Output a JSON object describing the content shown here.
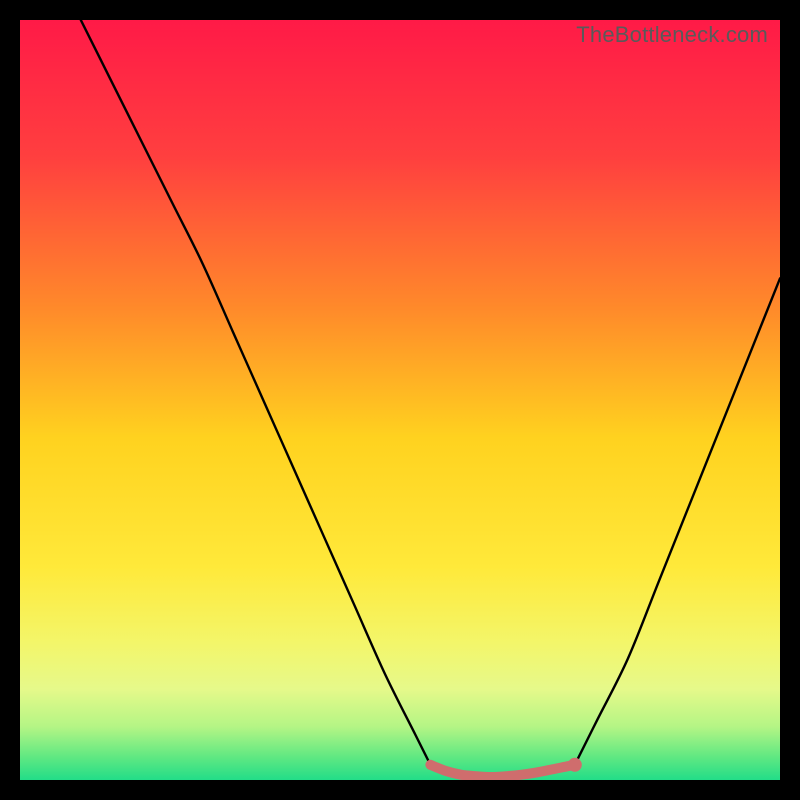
{
  "watermark": {
    "text": "TheBottleneck.com"
  },
  "chart_data": {
    "type": "line",
    "title": "",
    "xlabel": "",
    "ylabel": "",
    "xlim": [
      0,
      100
    ],
    "ylim": [
      0,
      100
    ],
    "series": [
      {
        "name": "curve-left",
        "x": [
          8,
          12,
          16,
          20,
          24,
          28,
          32,
          36,
          40,
          44,
          48,
          52,
          54
        ],
        "y": [
          100,
          92,
          84,
          76,
          68,
          59,
          50,
          41,
          32,
          23,
          14,
          6,
          2
        ],
        "color": "#000000"
      },
      {
        "name": "curve-right",
        "x": [
          73,
          76,
          80,
          84,
          88,
          92,
          96,
          100
        ],
        "y": [
          2,
          8,
          16,
          26,
          36,
          46,
          56,
          66
        ],
        "color": "#000000"
      },
      {
        "name": "highlight-flat",
        "x": [
          54,
          56,
          58,
          60,
          62,
          64,
          66,
          68,
          70,
          72,
          73
        ],
        "y": [
          2,
          1.2,
          0.7,
          0.5,
          0.4,
          0.5,
          0.7,
          1.0,
          1.4,
          1.8,
          2
        ],
        "color": "#cf6d6d"
      }
    ],
    "highlight_endpoint": {
      "x": 73,
      "y": 2,
      "color": "#cf6d6d"
    },
    "background_gradient": {
      "stops": [
        {
          "pct": 0,
          "color": "#ff1a47"
        },
        {
          "pct": 18,
          "color": "#ff3f3f"
        },
        {
          "pct": 38,
          "color": "#ff8a2a"
        },
        {
          "pct": 55,
          "color": "#ffd21f"
        },
        {
          "pct": 72,
          "color": "#ffe93a"
        },
        {
          "pct": 82,
          "color": "#f3f66a"
        },
        {
          "pct": 88,
          "color": "#e6f98a"
        },
        {
          "pct": 93,
          "color": "#b4f585"
        },
        {
          "pct": 97,
          "color": "#5fe882"
        },
        {
          "pct": 100,
          "color": "#22dd88"
        }
      ]
    }
  }
}
